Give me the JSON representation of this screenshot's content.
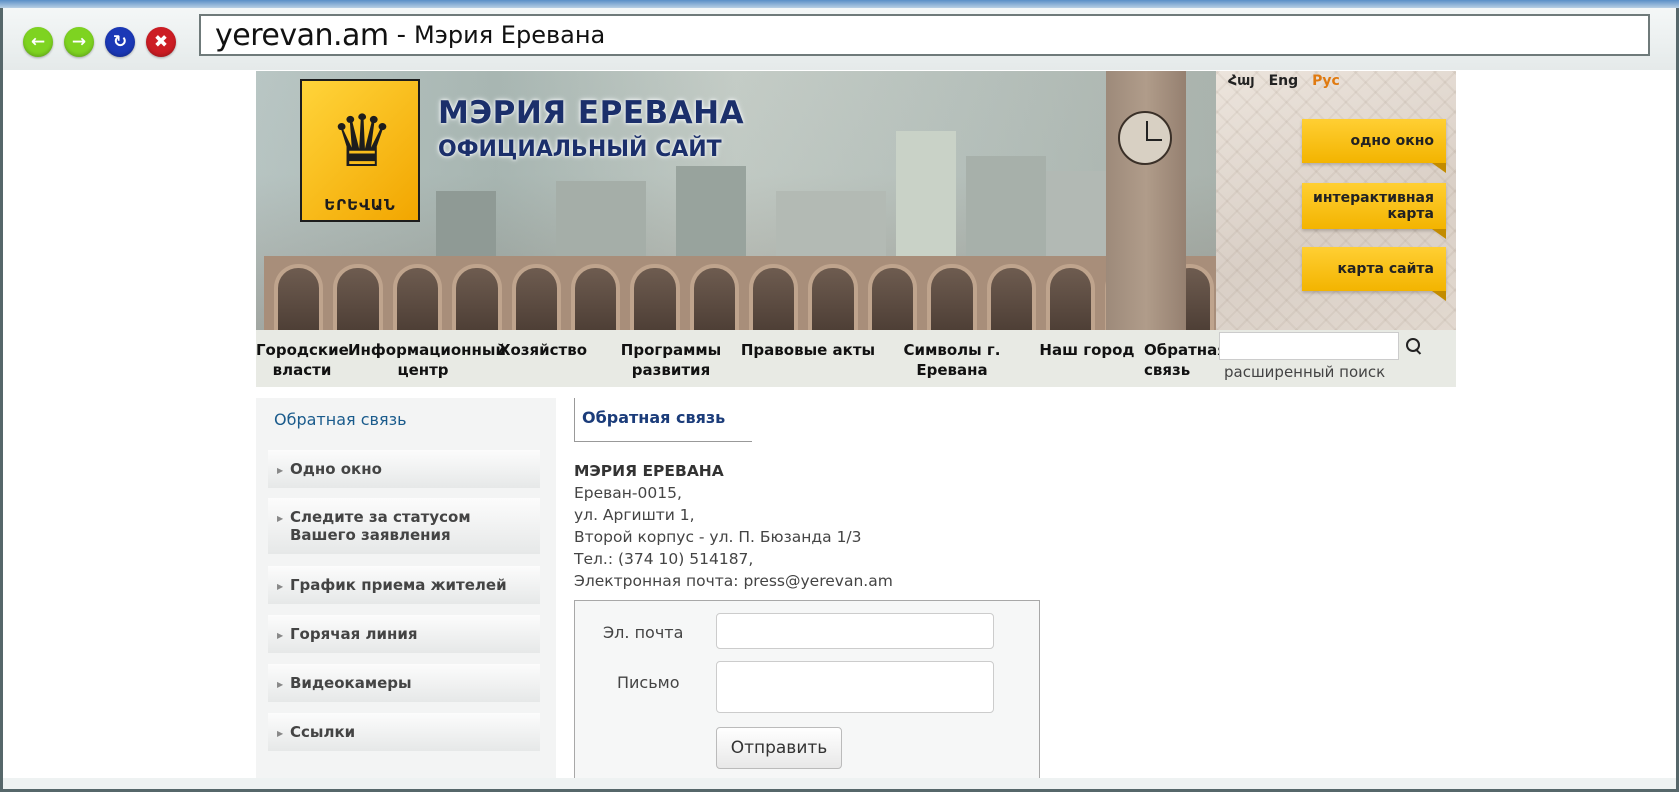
{
  "browser": {
    "domain": "yerevan.am",
    "separator": "-",
    "title": "Мэрия Еревана"
  },
  "header": {
    "logo_text": "ԵՐԵՎԱՆ",
    "title_line1": "МЭРИЯ ЕРЕВАНА",
    "title_line2": "ОФИЦИАЛЬНЫЙ САЙТ",
    "languages": [
      "Հայ",
      "Eng",
      "Рус"
    ],
    "active_language": "Рус",
    "quick_buttons": [
      "одно окно",
      "интерактивная карта",
      "карта сайта"
    ],
    "accent_color": "#f3b400"
  },
  "nav": {
    "items": [
      "Городские власти",
      "Информационный центр",
      "Хозяйство",
      "Программы развития",
      "Правовые акты",
      "Символы г. Еревана",
      "Наш город",
      "Обратная связь"
    ],
    "search_placeholder": "",
    "advanced_search": "расширенный поиск"
  },
  "sidebar": {
    "title": "Обратная связь",
    "items": [
      "Одно окно",
      "Следите за статусом Вашего заявления",
      "График приема жителей",
      "Горячая линия",
      "Видеокамеры",
      "Ссылки"
    ]
  },
  "main": {
    "tab": "Обратная связь",
    "address": {
      "org": "МЭРИЯ ЕРЕВАНА",
      "line1": "Ереван-0015,",
      "line2": "ул. Аргишти 1,",
      "line3": "Второй корпус - ул. П. Бюзанда 1/3",
      "phone": "Тел.: (374 10) 514187,",
      "email": "Электронная почта: press@yerevan.am"
    },
    "form": {
      "email_label": "Эл. почта",
      "email_value": "",
      "letter_label": "Письмо",
      "letter_value": "",
      "submit_label": "Отправить"
    }
  }
}
